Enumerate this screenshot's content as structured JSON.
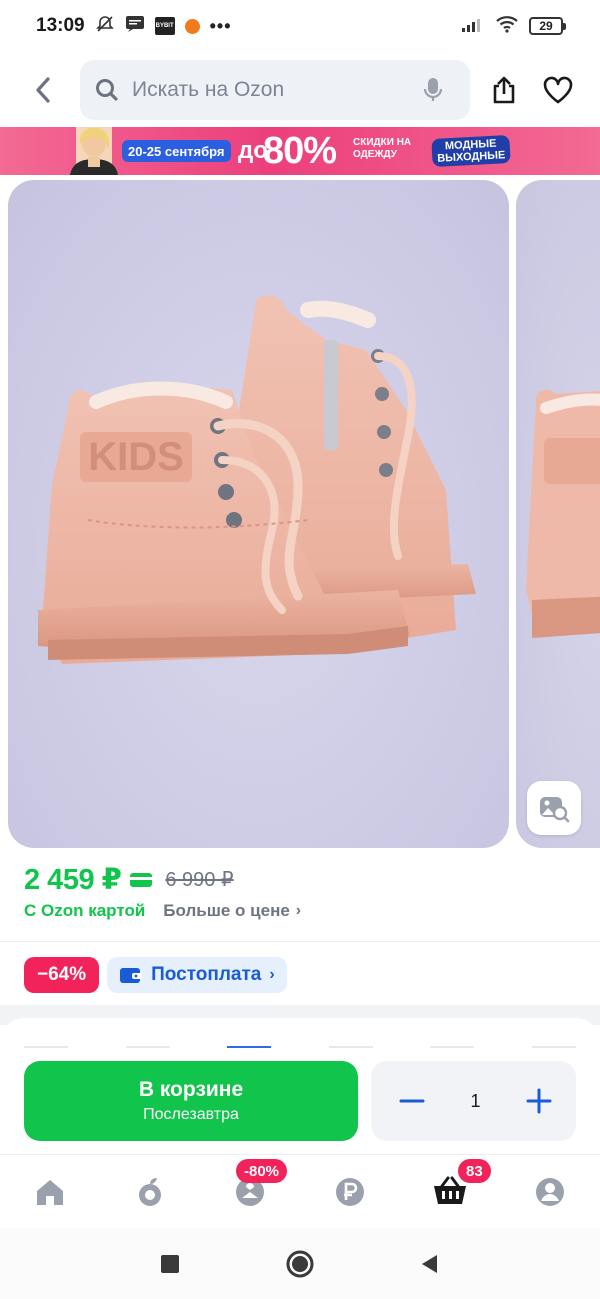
{
  "status_bar": {
    "time": "13:09",
    "left_icons": [
      "alarm-off-icon",
      "message-icon",
      "app-icon",
      "notification-dot-icon"
    ],
    "app_icon_text": "BYBIT",
    "more": "•••",
    "battery": "29",
    "right_icons": [
      "signal-icon",
      "wifi-icon",
      "battery-icon"
    ]
  },
  "header": {
    "back_icon": "chevron-left-icon",
    "search_placeholder": "Искать на Ozon",
    "search_icon": "search-icon",
    "mic_icon": "microphone-icon",
    "share_icon": "share-icon",
    "favorite_icon": "heart-icon"
  },
  "banner": {
    "dates": "20-25 сентября",
    "prefix": "до",
    "discount": "80%",
    "text": "СКИДКИ НА ОДЕЖДУ",
    "badge": "МОДНЫЕ ВЫХОДНЫЕ"
  },
  "gallery": {
    "image_search_icon": "image-search-icon",
    "shoe_brand_text": "KIDS"
  },
  "price": {
    "current": "2 459 ₽",
    "old": "6 990 ₽",
    "ozon_card": "С Ozon картой",
    "more_price": "Больше о цене",
    "chevron": "›",
    "card_icon": "ozon-card-icon"
  },
  "badges": {
    "discount": "−64%",
    "postpay": "Постоплата",
    "postpay_icon": "wallet-icon",
    "chevron": "›"
  },
  "actions": {
    "cart_title": "В корзине",
    "cart_sub": "Послезавтра",
    "quantity": "1",
    "minus_icon": "minus-icon",
    "plus_icon": "plus-icon"
  },
  "bottom_nav": {
    "items": [
      {
        "icon": "home-icon",
        "badge": ""
      },
      {
        "icon": "fresh-icon",
        "badge": ""
      },
      {
        "icon": "fashion-icon",
        "badge": "-80%"
      },
      {
        "icon": "ruble-icon",
        "badge": ""
      },
      {
        "icon": "cart-icon",
        "badge": "83"
      },
      {
        "icon": "profile-icon",
        "badge": ""
      }
    ]
  },
  "system_nav": {
    "items": [
      "recents-icon",
      "home-circle-icon",
      "back-triangle-icon"
    ]
  },
  "colors": {
    "green": "#10c44c",
    "blue": "#1a5bd6",
    "magenta": "#f1235a",
    "banner_pink": "#ec3f7c"
  }
}
